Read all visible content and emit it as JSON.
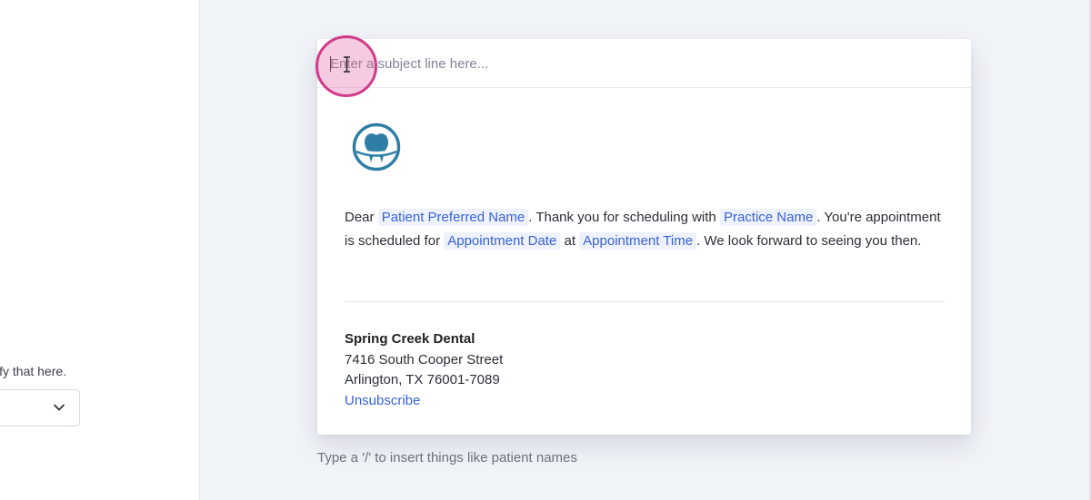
{
  "sidebar": {
    "helper_text": "ify that here.",
    "dropdown": {
      "value": "",
      "icon": "chevron-down-icon"
    }
  },
  "composer": {
    "subject_placeholder": "Enter a subject line here...",
    "logo_icon": "tooth-logo-icon",
    "body": {
      "t1": "Dear ",
      "token_patient": "Patient Preferred Name",
      "t2": ". Thank you for scheduling with ",
      "token_practice": "Practice Name",
      "t3": ". You're appointment is scheduled for ",
      "token_date": "Appointment Date",
      "t4": " at ",
      "token_time": "Appointment Time",
      "t5": ". We look forward to seeing you then."
    },
    "footer": {
      "practice_name": "Spring Creek Dental",
      "address_line1": "7416 South Cooper Street",
      "address_line2": "Arlington, TX 76001-7089",
      "unsubscribe": "Unsubscribe"
    },
    "hint": "Type a '/' to insert things like patient names"
  },
  "colors": {
    "accent": "#3a62d6",
    "token_bg": "#eef2fd",
    "logo": "#2f7ea6",
    "click_highlight": "#d13c8a",
    "page_bg": "#f0f3f8"
  }
}
